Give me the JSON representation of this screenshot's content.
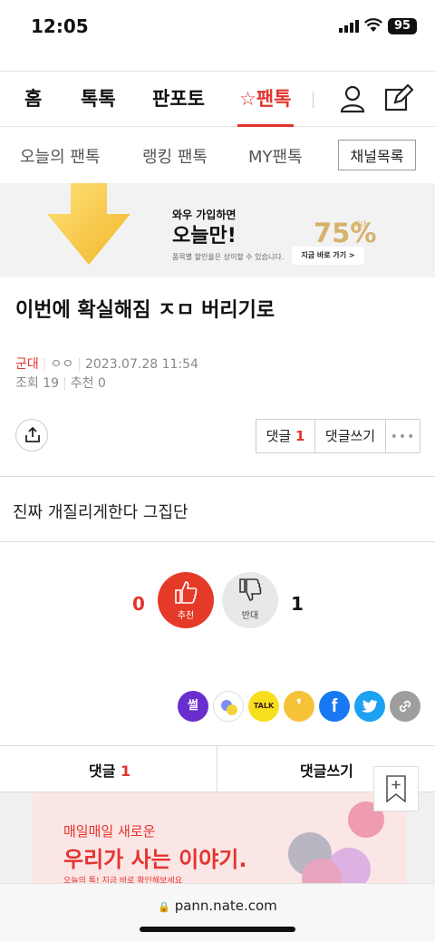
{
  "status": {
    "time": "12:05",
    "battery": "95"
  },
  "nav": {
    "home": "홈",
    "toktok": "톡톡",
    "pantoto": "판포토",
    "fantok": "팬톡"
  },
  "subnav": {
    "today": "오늘의 팬톡",
    "ranking": "랭킹 팬톡",
    "my": "MY팬톡",
    "channel_list": "채널목록"
  },
  "banner": {
    "line1": "와우 가입하면",
    "line2": "오늘만!",
    "line3": "품목별 할인율은 상이할 수 있습니다.",
    "percent": "75%",
    "percent_label": "최대",
    "cta": "지금 바로 가기 >"
  },
  "post": {
    "title": "이번에 확실해짐 ㅈㅁ 버리기로",
    "category": "군대",
    "author": "ㅇㅇ",
    "datetime": "2023.07.28 11:54",
    "views": "조회 19",
    "recommends": "추천 0",
    "body": "진짜 개질리게한다 그집단"
  },
  "actions": {
    "comments_label": "댓글",
    "comments_count": "1",
    "write": "댓글쓰기"
  },
  "vote": {
    "up_count": "0",
    "up_label": "추천",
    "down_count": "1",
    "down_label": "반대"
  },
  "bottom_tabs": {
    "comments_label": "댓글",
    "comments_count": "1",
    "write": "댓글쓰기"
  },
  "promo": {
    "line1": "매일매일 새로운",
    "line2": "우리가 사는 이야기.",
    "line3": "오늘의 톡! 지금 바로 확인해보세요"
  },
  "browser": {
    "url": "pann.nate.com"
  },
  "colors": {
    "accent": "#e3342f",
    "gold": "#d6b26a"
  }
}
